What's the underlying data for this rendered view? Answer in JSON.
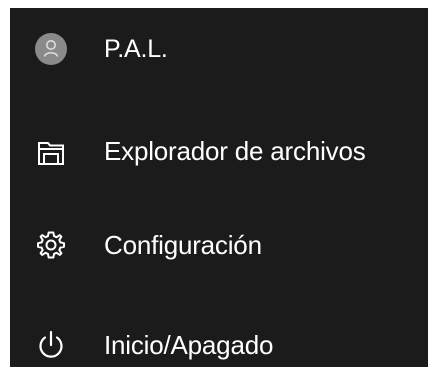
{
  "start_menu": {
    "items": [
      {
        "label": "P.A.L.",
        "icon": "user-avatar-icon"
      },
      {
        "label": "Explorador de archivos",
        "icon": "folder-icon"
      },
      {
        "label": "Configuración",
        "icon": "gear-icon"
      },
      {
        "label": "Inicio/Apagado",
        "icon": "power-icon"
      }
    ]
  },
  "colors": {
    "menu_background": "#1b1b1b",
    "text": "#ffffff",
    "avatar_fill": "#8a8a8a",
    "icon_stroke": "#ffffff"
  }
}
